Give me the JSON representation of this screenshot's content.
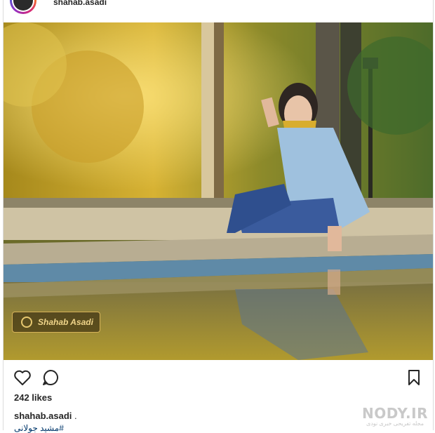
{
  "post": {
    "username": "shahab.asadi",
    "likes": "242 likes",
    "caption_user": "shahab.asadi",
    "caption_separator": " .",
    "hashtag": "#مشید جولانی"
  },
  "photo": {
    "badge_text": "Shahab Asadi"
  },
  "watermark": {
    "main": "NODY.IR",
    "sub": "مجله تفریحی خبری نودی"
  },
  "icons": {
    "like": "heart-icon",
    "comment": "comment-icon",
    "save": "bookmark-icon"
  }
}
